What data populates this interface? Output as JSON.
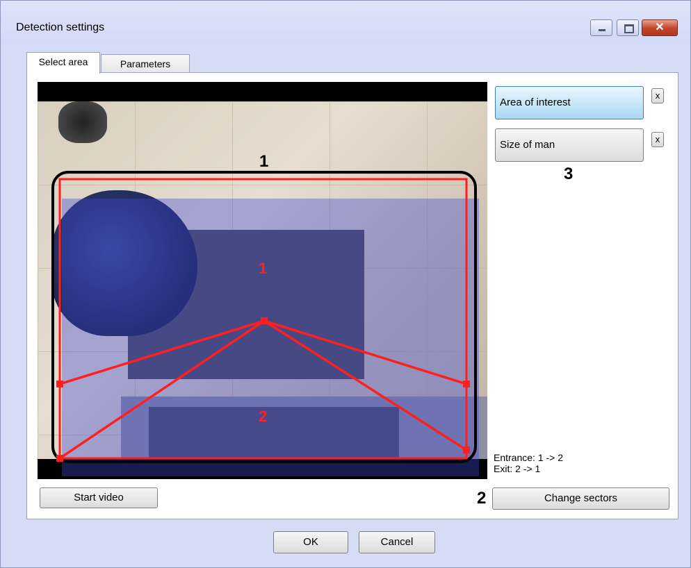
{
  "window": {
    "title": "Detection settings",
    "controls": {
      "minimize": "minimize",
      "maximize": "maximize",
      "close": "✕"
    }
  },
  "tabs": [
    {
      "label": "Select area",
      "active": true
    },
    {
      "label": "Parameters",
      "active": false
    }
  ],
  "video": {
    "sectors": [
      "1",
      "2"
    ],
    "callouts": [
      "1",
      "2",
      "3"
    ]
  },
  "side": {
    "area_of_interest_label": "Area of interest",
    "size_of_man_label": "Size of man",
    "remove_label": "x",
    "legend_entrance": "Entrance: 1 -> 2",
    "legend_exit": "Exit: 2 -> 1"
  },
  "bottom": {
    "start_video_label": "Start video",
    "change_sectors_label": "Change sectors"
  },
  "footer": {
    "ok_label": "OK",
    "cancel_label": "Cancel"
  },
  "colors": {
    "accent_red": "#ff1f1f",
    "selected_blue": "#a9d9f2"
  }
}
